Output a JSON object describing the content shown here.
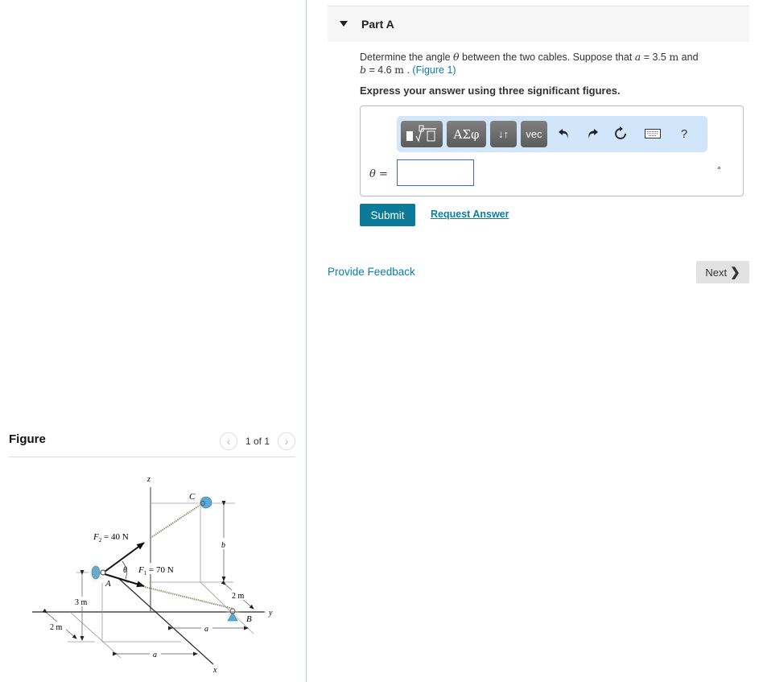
{
  "figure_panel": {
    "title": "Figure",
    "pager_text": "1 of 1",
    "prev_icon": "chevron-left-icon",
    "next_icon": "chevron-right-icon",
    "diagram": {
      "axis_labels": {
        "x": "x",
        "y": "y",
        "z": "z"
      },
      "points": {
        "A": "A",
        "B": "B",
        "C": "C"
      },
      "forces": {
        "f2": "F",
        "f2_sub": "2",
        "f2_val": " = 40 N",
        "f1": "F",
        "f1_sub": "1",
        "f1_val": " = 70 N"
      },
      "angle_label": "θ",
      "dims": {
        "three_m": "3 m",
        "two_m_left": "2 m",
        "two_m_right": "2 m",
        "a_bottom": "a",
        "a_right": "a",
        "b": "b"
      }
    }
  },
  "part": {
    "title": "Part A",
    "question": {
      "prefix": "Determine the angle ",
      "theta": "θ",
      "mid": " between the two cables. Suppose that ",
      "a_var": "a",
      "a_eq": " = 3.5 ",
      "a_unit": "m",
      "and": " and",
      "b_var": "b",
      "b_eq": " = 4.6 ",
      "b_unit": "m",
      "dot": " . ",
      "figure_link": "(Figure 1)"
    },
    "instruction": "Express your answer using three significant figures.",
    "toolbar": {
      "templates_icon": "fraction-radical-icon",
      "greek_label": "ΑΣφ",
      "arrows_label": "↓↑",
      "vec_label": "vec",
      "undo_icon": "undo-icon",
      "redo_icon": "redo-icon",
      "reset_icon": "reset-icon",
      "keyboard_icon": "keyboard-icon",
      "help_label": "?"
    },
    "answer": {
      "label": "θ =",
      "value": "",
      "placeholder": "",
      "unit": "°"
    },
    "submit_label": "Submit",
    "request_answer_label": "Request Answer"
  },
  "footer": {
    "feedback_label": "Provide Feedback",
    "next_label": "Next",
    "next_icon": "❯"
  },
  "colors": {
    "accent": "#0b7a9a",
    "link": "#0b7ea3",
    "toolbar_bg": "#d1e6fb",
    "input_border": "#3a6bc8"
  }
}
